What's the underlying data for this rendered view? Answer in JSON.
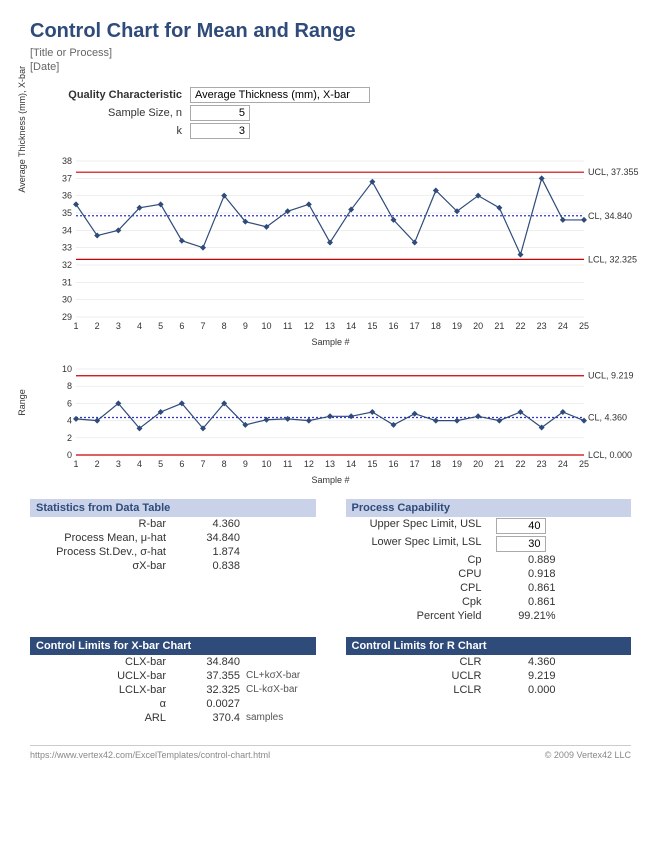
{
  "title": "Control Chart for Mean and Range",
  "subtitle1": "[Title or Process]",
  "subtitle2": "[Date]",
  "quality": {
    "label": "Quality Characteristic",
    "value": "Average Thickness (mm), X-bar",
    "sample_size_label": "Sample Size, n",
    "sample_size": "5",
    "k_label": "k",
    "k": "3"
  },
  "chart_data": [
    {
      "type": "line",
      "title": "",
      "xlabel": "Sample #",
      "ylabel": "Average Thickness (mm), X-bar",
      "x": [
        1,
        2,
        3,
        4,
        5,
        6,
        7,
        8,
        9,
        10,
        11,
        12,
        13,
        14,
        15,
        16,
        17,
        18,
        19,
        20,
        21,
        22,
        23,
        24,
        25
      ],
      "values": [
        35.5,
        33.7,
        34.0,
        35.3,
        35.5,
        33.4,
        33.0,
        36.0,
        34.5,
        34.2,
        35.1,
        35.5,
        33.3,
        35.2,
        36.8,
        34.6,
        33.3,
        36.3,
        35.1,
        36.0,
        35.3,
        32.6,
        37.0,
        34.6,
        34.6
      ],
      "ylim": [
        29,
        38
      ],
      "yticks": [
        29,
        30,
        31,
        32,
        33,
        34,
        35,
        36,
        37,
        38
      ],
      "lines": {
        "UCL": 37.355,
        "CL": 34.84,
        "LCL": 32.325
      },
      "annotations": {
        "UCL": "UCL, 37.355",
        "CL": "CL, 34.840",
        "LCL": "LCL, 32.325"
      }
    },
    {
      "type": "line",
      "title": "",
      "xlabel": "Sample #",
      "ylabel": "Range",
      "x": [
        1,
        2,
        3,
        4,
        5,
        6,
        7,
        8,
        9,
        10,
        11,
        12,
        13,
        14,
        15,
        16,
        17,
        18,
        19,
        20,
        21,
        22,
        23,
        24,
        25
      ],
      "values": [
        4.2,
        4.0,
        6.0,
        3.1,
        5.0,
        6.0,
        3.1,
        6.0,
        3.5,
        4.1,
        4.2,
        4.0,
        4.5,
        4.5,
        5.0,
        3.5,
        4.8,
        4.0,
        4.0,
        4.5,
        4.0,
        5.0,
        3.2,
        5.0,
        4.0
      ],
      "ylim": [
        0,
        10
      ],
      "yticks": [
        0,
        2,
        4,
        6,
        8,
        10
      ],
      "lines": {
        "UCL": 9.219,
        "CL": 4.36,
        "LCL": 0.0
      },
      "annotations": {
        "UCL": "UCL, 9.219",
        "CL": "CL, 4.360",
        "LCL": "LCL, 0.000"
      }
    }
  ],
  "stats": {
    "header": "Statistics from Data Table",
    "rows": [
      {
        "label": "R-bar",
        "value": "4.360"
      },
      {
        "label": "Process Mean, μ-hat",
        "value": "34.840"
      },
      {
        "label": "Process St.Dev., σ-hat",
        "value": "1.874"
      },
      {
        "label": "σX-bar",
        "value": "0.838"
      }
    ]
  },
  "capability": {
    "header": "Process Capability",
    "usl_label": "Upper Spec Limit, USL",
    "usl": "40",
    "lsl_label": "Lower Spec Limit, LSL",
    "lsl": "30",
    "rows": [
      {
        "label": "Cp",
        "value": "0.889"
      },
      {
        "label": "CPU",
        "value": "0.918"
      },
      {
        "label": "CPL",
        "value": "0.861"
      },
      {
        "label": "Cpk",
        "value": "0.861"
      },
      {
        "label": "Percent Yield",
        "value": "99.21%"
      }
    ]
  },
  "limits_x": {
    "header": "Control Limits for X-bar Chart",
    "rows": [
      {
        "label": "CLX-bar",
        "value": "34.840",
        "note": ""
      },
      {
        "label": "UCLX-bar",
        "value": "37.355",
        "note": "CL+kσX-bar"
      },
      {
        "label": "LCLX-bar",
        "value": "32.325",
        "note": "CL-kσX-bar"
      },
      {
        "label": "α",
        "value": "0.0027",
        "note": ""
      },
      {
        "label": "ARL",
        "value": "370.4",
        "note": "samples"
      }
    ]
  },
  "limits_r": {
    "header": "Control Limits for R Chart",
    "rows": [
      {
        "label": "CLR",
        "value": "4.360"
      },
      {
        "label": "UCLR",
        "value": "9.219"
      },
      {
        "label": "LCLR",
        "value": "0.000"
      }
    ]
  },
  "footer": {
    "url": "https://www.vertex42.com/ExcelTemplates/control-chart.html",
    "copyright": "© 2009 Vertex42 LLC"
  }
}
